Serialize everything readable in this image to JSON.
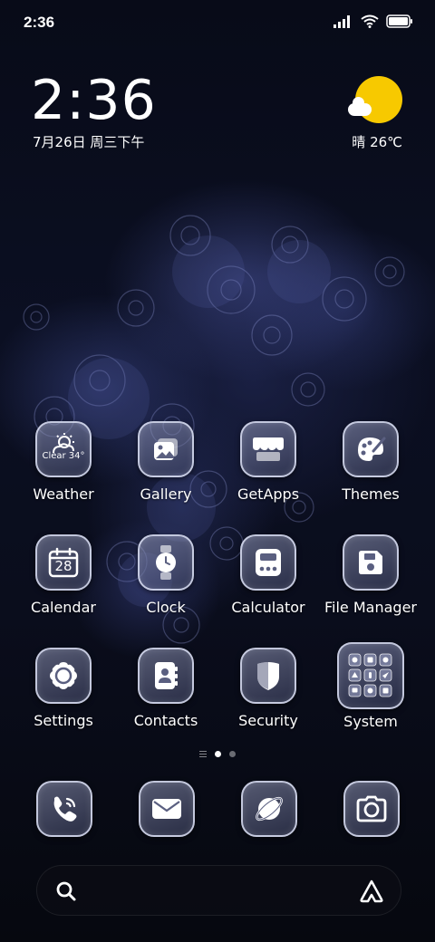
{
  "status_bar": {
    "time": "2:36",
    "icons": [
      "signal-icon",
      "wifi-icon",
      "battery-icon"
    ]
  },
  "clock_widget": {
    "time": "2:36",
    "date": "7月26日 周三下午"
  },
  "weather_widget": {
    "condition_icon": "sun-cloud-icon",
    "text": "晴 26℃"
  },
  "apps": [
    {
      "label": "Weather",
      "icon": "weather-icon",
      "badge": "Clear 34°"
    },
    {
      "label": "Gallery",
      "icon": "gallery-icon"
    },
    {
      "label": "GetApps",
      "icon": "store-icon"
    },
    {
      "label": "Themes",
      "icon": "palette-icon"
    },
    {
      "label": "Calendar",
      "icon": "calendar-icon",
      "day": "28"
    },
    {
      "label": "Clock",
      "icon": "watch-icon"
    },
    {
      "label": "Calculator",
      "icon": "calculator-icon"
    },
    {
      "label": "File Manager",
      "icon": "floppy-icon"
    },
    {
      "label": "Settings",
      "icon": "settings-icon"
    },
    {
      "label": "Contacts",
      "icon": "contacts-icon"
    },
    {
      "label": "Security",
      "icon": "shield-icon"
    },
    {
      "label": "System",
      "icon": "folder-icon"
    }
  ],
  "page_indicator": {
    "pages": 2,
    "current": 1
  },
  "dock": [
    {
      "name": "phone",
      "icon": "phone-icon"
    },
    {
      "name": "messages",
      "icon": "mail-icon"
    },
    {
      "name": "browser",
      "icon": "planet-icon"
    },
    {
      "name": "camera",
      "icon": "camera-icon"
    }
  ],
  "search_bar": {
    "left_icon": "search-icon",
    "right_icon": "assistant-icon"
  },
  "colors": {
    "background": "#070a14",
    "sun": "#f7c900",
    "icon_border": "#dce0f5"
  }
}
